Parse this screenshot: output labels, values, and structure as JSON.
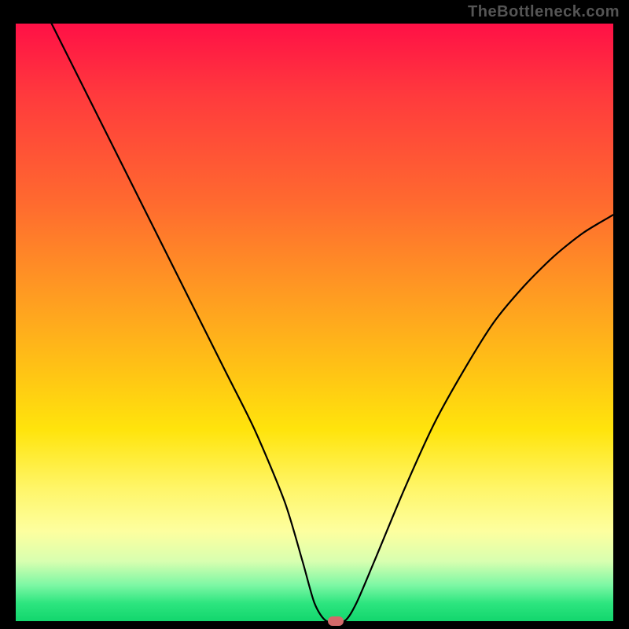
{
  "watermark": "TheBottleneck.com",
  "colors": {
    "frame": "#000000",
    "curve_stroke": "#000000",
    "marker_fill": "#d46a6a",
    "gradient_top": "#ff1046",
    "gradient_bottom": "#12d66d"
  },
  "chart_data": {
    "type": "line",
    "title": "",
    "xlabel": "",
    "ylabel": "",
    "xlim": [
      0,
      100
    ],
    "ylim": [
      0,
      100
    ],
    "x": [
      6,
      10,
      15,
      20,
      25,
      30,
      35,
      40,
      45,
      48,
      50,
      52,
      55,
      57,
      60,
      65,
      70,
      75,
      80,
      85,
      90,
      95,
      100
    ],
    "values": [
      100,
      92,
      82,
      72,
      62,
      52,
      42,
      32,
      20,
      10,
      3,
      0,
      0,
      3,
      10,
      22,
      33,
      42,
      50,
      56,
      61,
      65,
      68
    ],
    "marker": {
      "x": 53.5,
      "y": 0
    },
    "notes": "V-shaped bottleneck curve; minimum (optimal match) around x≈53. Values are percentages read from the vertical position against the gradient (0 at bottom/green, 100 at top/red)."
  }
}
